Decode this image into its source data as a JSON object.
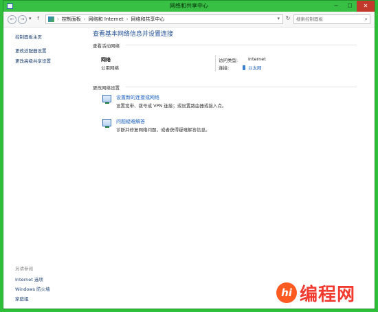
{
  "window": {
    "title": "网络和共享中心",
    "controls": [
      "─",
      "☐",
      "✕"
    ]
  },
  "addressbar": {
    "back": "←",
    "forward": "→",
    "up": "↑",
    "breadcrumbs": [
      "控制面板",
      "网络和 Internet",
      "网络和共享中心"
    ],
    "separator": "›",
    "dropdown": "▾",
    "refresh": "↻",
    "search_placeholder": "搜索控制面板",
    "search_icon_glyph": "⌕"
  },
  "sidebar": {
    "items": [
      "控制面板主页",
      "更改适配器设置",
      "更改高级共享设置"
    ],
    "see_also_header": "另请参阅",
    "see_also": [
      "Internet 选项",
      "Windows 防火墙",
      "家庭组"
    ]
  },
  "main": {
    "title": "查看基本网络信息并设置连接",
    "active_networks_header": "查看活动网络",
    "network_name": "网络",
    "network_type": "公用网络",
    "access_type_label": "访问类型:",
    "access_type_value": "Internet",
    "connections_label": "连接:",
    "connection_value": "以太网",
    "change_settings_header": "更改网络设置",
    "tasks": [
      {
        "title": "设置新的连接或网络",
        "desc": "设置宽带、拨号或 VPN 连接；或设置路由器或接入点。",
        "icon": "network-setup-icon"
      },
      {
        "title": "问题疑难解答",
        "desc": "诊断并修复网络问题，或者获得疑难解答信息。",
        "icon": "troubleshoot-icon"
      }
    ]
  },
  "watermark": {
    "logo": "hi",
    "text": "编程网"
  },
  "colors": {
    "title_bar": "#38c045",
    "link": "#1a5fbf",
    "heading": "#1f4e96",
    "watermark": "#f23a2f"
  }
}
